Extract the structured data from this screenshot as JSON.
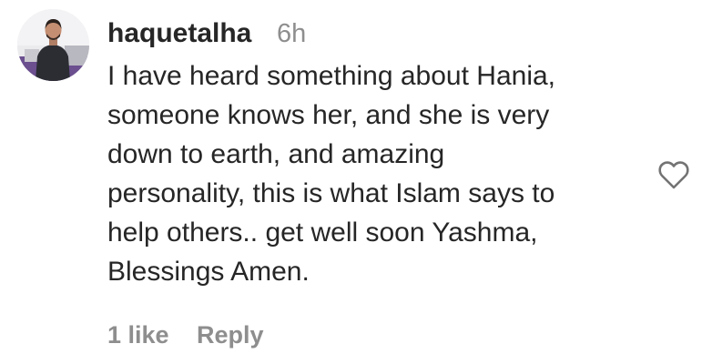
{
  "comment": {
    "username": "haquetalha",
    "time": "6h",
    "text_lines": [
      "I have heard something about Hania,",
      "someone knows her, and she is very",
      "down to earth, and amazing",
      "personality, this is what Islam says to",
      "help others.. get well soon Yashma,",
      "Blessings Amen."
    ],
    "likes_label": "1 like",
    "reply_label": "Reply",
    "icons": {
      "like": "heart-outline-icon",
      "avatar": "profile-photo"
    }
  },
  "colors": {
    "text_primary": "#262626",
    "text_secondary": "#8e8e8e",
    "background": "#ffffff"
  }
}
